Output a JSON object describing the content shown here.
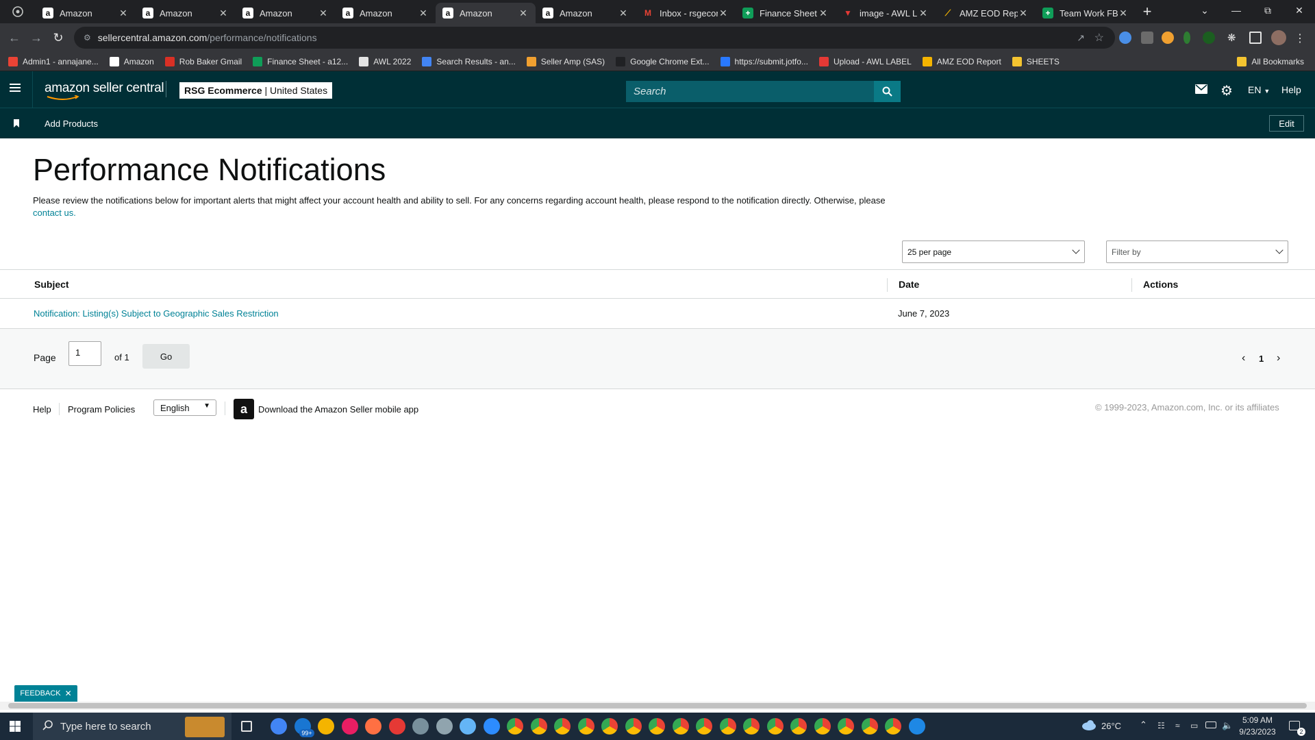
{
  "browser": {
    "tabs": [
      {
        "title": "Amazon",
        "favicon": "amazon-icon",
        "active": false
      },
      {
        "title": "Amazon",
        "favicon": "amazon-icon",
        "active": false
      },
      {
        "title": "Amazon",
        "favicon": "amazon-icon",
        "active": false
      },
      {
        "title": "Amazon",
        "favicon": "amazon-icon",
        "active": false
      },
      {
        "title": "Amazon",
        "favicon": "amazon-icon",
        "active": true
      },
      {
        "title": "Amazon",
        "favicon": "amazon-icon",
        "active": false
      },
      {
        "title": "Inbox - rsgecon",
        "favicon": "gmail-icon",
        "active": false
      },
      {
        "title": "Finance Sheet",
        "favicon": "sheets-icon",
        "active": false
      },
      {
        "title": "image - AWL L",
        "favicon": "awl-icon",
        "active": false
      },
      {
        "title": "AMZ EOD Rep",
        "favicon": "eod-icon",
        "active": false
      },
      {
        "title": "Team Work FBA",
        "favicon": "sheets-icon",
        "active": false
      }
    ],
    "url_host": "sellercentral.amazon.com",
    "url_path": "/performance/notifications",
    "bookmarks": [
      "Admin1 - annajane...",
      "Amazon",
      "Rob Baker Gmail",
      "Finance Sheet - a12...",
      "AWL 2022",
      "Search Results - an...",
      "Seller Amp (SAS)",
      "Google Chrome Ext...",
      "https://submit.jotfo...",
      "Upload - AWL LABEL",
      "AMZ EOD Report",
      "SHEETS"
    ],
    "all_bookmarks": "All Bookmarks"
  },
  "header": {
    "logo": "amazon seller central",
    "account_name": "RSG Ecommerce",
    "marketplace": "United States",
    "search_placeholder": "Search",
    "language": "EN",
    "help": "Help"
  },
  "subnav": {
    "add_products": "Add Products",
    "edit": "Edit"
  },
  "page": {
    "title": "Performance Notifications",
    "description": "Please review the notifications below for important alerts that might affect your account health and ability to sell. For any concerns regarding account health, please respond to the notification directly. Otherwise, please ",
    "contact_link": "contact us.",
    "per_page": "25 per page",
    "filter_by": "Filter by"
  },
  "table": {
    "columns": [
      "Subject",
      "Date",
      "Actions"
    ],
    "rows": [
      {
        "subject": "Notification: Listing(s) Subject to Geographic Sales Restriction",
        "date": "June 7, 2023",
        "actions": ""
      }
    ]
  },
  "pagination": {
    "page_label": "Page",
    "current_page": "1",
    "of_label": "of 1",
    "go": "Go",
    "page_number": "1"
  },
  "footer": {
    "help": "Help",
    "program_policies": "Program Policies",
    "language_select": "English",
    "download_app": "Download the Amazon Seller mobile app",
    "copyright": "© 1999-2023, Amazon.com, Inc. or its affiliates"
  },
  "feedback": "FEEDBACK",
  "taskbar": {
    "search_placeholder": "Type here to search",
    "temperature": "26°C",
    "time": "5:09 AM",
    "date": "9/23/2023",
    "mail_badge": "99+",
    "notification_count": "2"
  },
  "colors": {
    "sc_header": "#002f36",
    "link": "#008296",
    "chrome_dark": "#202124"
  }
}
